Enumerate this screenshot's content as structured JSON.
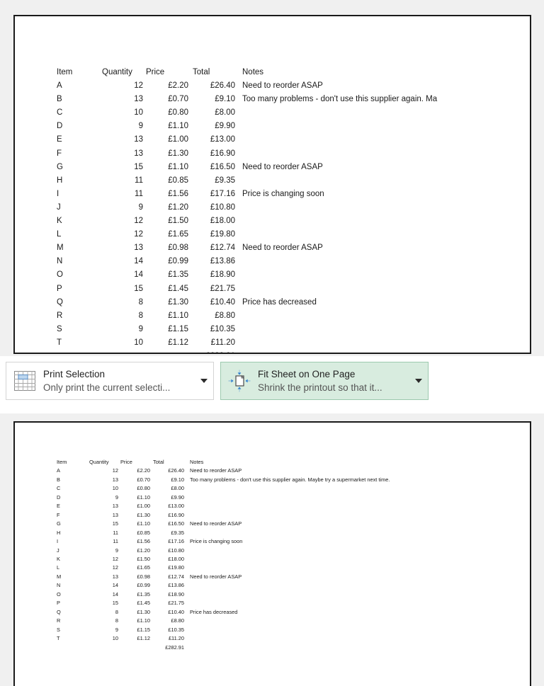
{
  "table": {
    "headers": [
      "Item",
      "Quantity",
      "Price",
      "Total",
      "Notes"
    ],
    "rows": [
      {
        "item": "A",
        "quantity": "12",
        "price": "£2.20",
        "total": "£26.40",
        "notes": "Need to reorder ASAP",
        "notes_clipped": "Need to reorder ASAP"
      },
      {
        "item": "B",
        "quantity": "13",
        "price": "£0.70",
        "total": "£9.10",
        "notes": "Too many problems - don't use this supplier again. Maybe try a supermarket next time.",
        "notes_clipped": "Too many problems - don't use this supplier again. Ma"
      },
      {
        "item": "C",
        "quantity": "10",
        "price": "£0.80",
        "total": "£8.00",
        "notes": "",
        "notes_clipped": ""
      },
      {
        "item": "D",
        "quantity": "9",
        "price": "£1.10",
        "total": "£9.90",
        "notes": "",
        "notes_clipped": ""
      },
      {
        "item": "E",
        "quantity": "13",
        "price": "£1.00",
        "total": "£13.00",
        "notes": "",
        "notes_clipped": ""
      },
      {
        "item": "F",
        "quantity": "13",
        "price": "£1.30",
        "total": "£16.90",
        "notes": "",
        "notes_clipped": ""
      },
      {
        "item": "G",
        "quantity": "15",
        "price": "£1.10",
        "total": "£16.50",
        "notes": "Need to reorder ASAP",
        "notes_clipped": "Need to reorder ASAP"
      },
      {
        "item": "H",
        "quantity": "11",
        "price": "£0.85",
        "total": "£9.35",
        "notes": "",
        "notes_clipped": ""
      },
      {
        "item": "I",
        "quantity": "11",
        "price": "£1.56",
        "total": "£17.16",
        "notes": "Price is changing soon",
        "notes_clipped": "Price is changing soon"
      },
      {
        "item": "J",
        "quantity": "9",
        "price": "£1.20",
        "total": "£10.80",
        "notes": "",
        "notes_clipped": ""
      },
      {
        "item": "K",
        "quantity": "12",
        "price": "£1.50",
        "total": "£18.00",
        "notes": "",
        "notes_clipped": ""
      },
      {
        "item": "L",
        "quantity": "12",
        "price": "£1.65",
        "total": "£19.80",
        "notes": "",
        "notes_clipped": ""
      },
      {
        "item": "M",
        "quantity": "13",
        "price": "£0.98",
        "total": "£12.74",
        "notes": "Need to reorder ASAP",
        "notes_clipped": "Need to reorder ASAP"
      },
      {
        "item": "N",
        "quantity": "14",
        "price": "£0.99",
        "total": "£13.86",
        "notes": "",
        "notes_clipped": ""
      },
      {
        "item": "O",
        "quantity": "14",
        "price": "£1.35",
        "total": "£18.90",
        "notes": "",
        "notes_clipped": ""
      },
      {
        "item": "P",
        "quantity": "15",
        "price": "£1.45",
        "total": "£21.75",
        "notes": "",
        "notes_clipped": ""
      },
      {
        "item": "Q",
        "quantity": "8",
        "price": "£1.30",
        "total": "£10.40",
        "notes": "Price has decreased",
        "notes_clipped": "Price has decreased"
      },
      {
        "item": "R",
        "quantity": "8",
        "price": "£1.10",
        "total": "£8.80",
        "notes": "",
        "notes_clipped": ""
      },
      {
        "item": "S",
        "quantity": "9",
        "price": "£1.15",
        "total": "£10.35",
        "notes": "",
        "notes_clipped": ""
      },
      {
        "item": "T",
        "quantity": "10",
        "price": "£1.12",
        "total": "£11.20",
        "notes": "",
        "notes_clipped": ""
      }
    ],
    "grand_total": "£282.91"
  },
  "settings": {
    "print_selection": {
      "title": "Print Selection",
      "description": "Only print the current selecti...",
      "icon": "worksheet-grid-icon"
    },
    "fit_sheet": {
      "title": "Fit Sheet on One Page",
      "description": "Shrink the printout so that it...",
      "icon": "shrink-to-fit-icon",
      "highlight_color": "#d8ecdf",
      "border_color": "#9cc9ae"
    },
    "dropdown_icon": "chevron-down-icon"
  }
}
